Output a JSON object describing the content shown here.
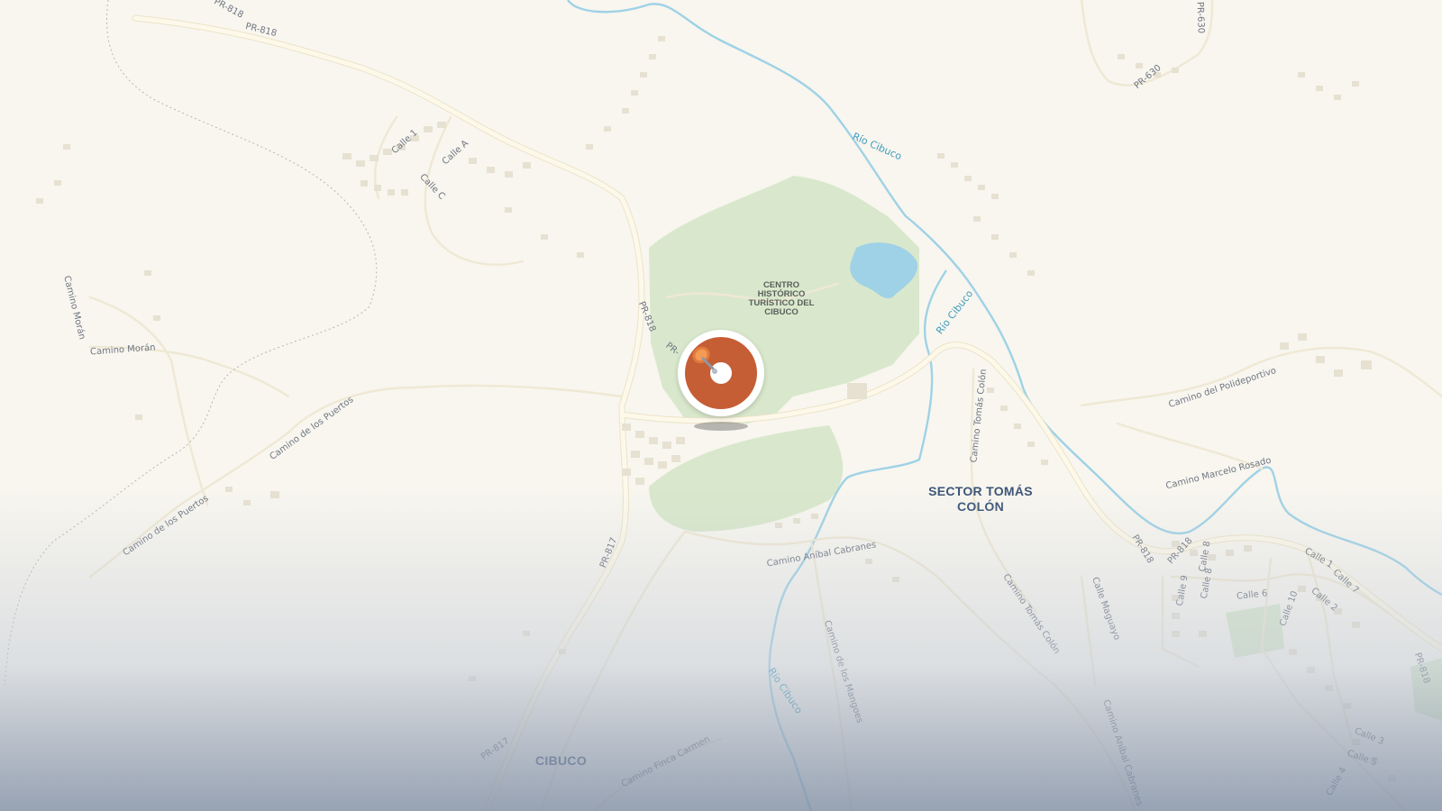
{
  "map": {
    "roads": {
      "pr818_a": "PR-818",
      "pr818_b": "PR-818",
      "pr818_c": "PR-818",
      "pr818_d": "PR-",
      "pr818_e": "PR-818",
      "pr818_f": "PR-818",
      "pr818_g": "PR-818",
      "pr630_a": "PR-630",
      "pr630_b": "PR-630",
      "pr817_a": "PR-817",
      "pr817_b": "PR-817",
      "calle1": "Calle 1",
      "callea": "Calle A",
      "callec": "Calle C",
      "camino_moran_v": "Camino Morán",
      "camino_moran_h": "Camino Morán",
      "camino_puertos_a": "Camino de los Puertos",
      "camino_puertos_b": "Camino de los Puertos",
      "camino_anibal": "Camino Aníbal Cabranes",
      "camino_tomas_v": "Camino Tomás Colón",
      "camino_tomas_d": "Camino Tomás Colón",
      "camino_mangoes": "Camino de los Mangoes",
      "camino_finca": "Camino Finca Carmen",
      "camino_polideportivo": "Camino del Polideportivo",
      "camino_marcelo": "Camino Marcelo Rosado",
      "calle_maguayo": "Calle Maguayo",
      "camino_anibal_b": "Camino Aníbal Cabranes",
      "calle8": "Calle 8",
      "calle9": "Calle 9",
      "calle6": "Calle 6",
      "calle10": "Calle 10",
      "calle1b": "Calle 1",
      "calle7": "Calle 7",
      "calle2": "Calle 2",
      "calle3": "Calle 3",
      "calle5": "Calle 5",
      "calle4": "Calle 4"
    },
    "water": {
      "rio1": "Río Cibuco",
      "rio2": "Río Cibuco",
      "rio3": "Río Cibuco"
    },
    "places": {
      "poi_line1": "CENTRO",
      "poi_line2": "HISTÓRICO",
      "poi_line3": "TURÍSTICO DEL",
      "poi_line4": "CIBUCO",
      "sector_line1": "SECTOR TOMÁS",
      "sector_line2": "COLÓN",
      "cibuco": "CIBUCO"
    },
    "colors": {
      "land": "#f8f6ef",
      "park": "#d9e8cc",
      "water": "#9fd2e6",
      "road": "#fdf9ea",
      "road_casing": "#ece3c8",
      "building": "#e7e1d2",
      "marker": "#c55d35"
    }
  },
  "marker": {
    "icon": "pin-icon"
  }
}
